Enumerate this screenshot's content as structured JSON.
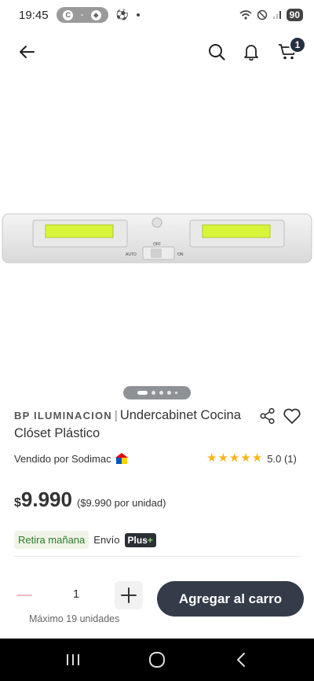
{
  "status_bar": {
    "time": "19:45",
    "pill_icon": "C",
    "pill_dash": "-",
    "battery": "90"
  },
  "header": {
    "cart_count": "1"
  },
  "product": {
    "brand": "BP ILUMINACION",
    "separator": "|",
    "title": "Undercabinet Cocina Clóset Plástico",
    "seller": "Vendido por Sodimac",
    "rating_stars": 5,
    "rating_text": "5.0 (1)",
    "price_symbol": "$",
    "price_amount": "9.990",
    "price_unit": "($9.990 por unidad)"
  },
  "delivery": {
    "pickup": "Retira mañana",
    "shipping": "Envío",
    "plus_label": "Plus",
    "plus_mark": "+"
  },
  "quantity": {
    "value": "1",
    "max_note": "Máximo 19 unidades"
  },
  "cta": {
    "add_to_cart": "Agregar al carro"
  },
  "carousel": {
    "total": 5,
    "active": 0
  },
  "colors": {
    "primary_dark": "#333c48",
    "star": "#f5b51b",
    "pickup_green": "#2d7a2d"
  }
}
